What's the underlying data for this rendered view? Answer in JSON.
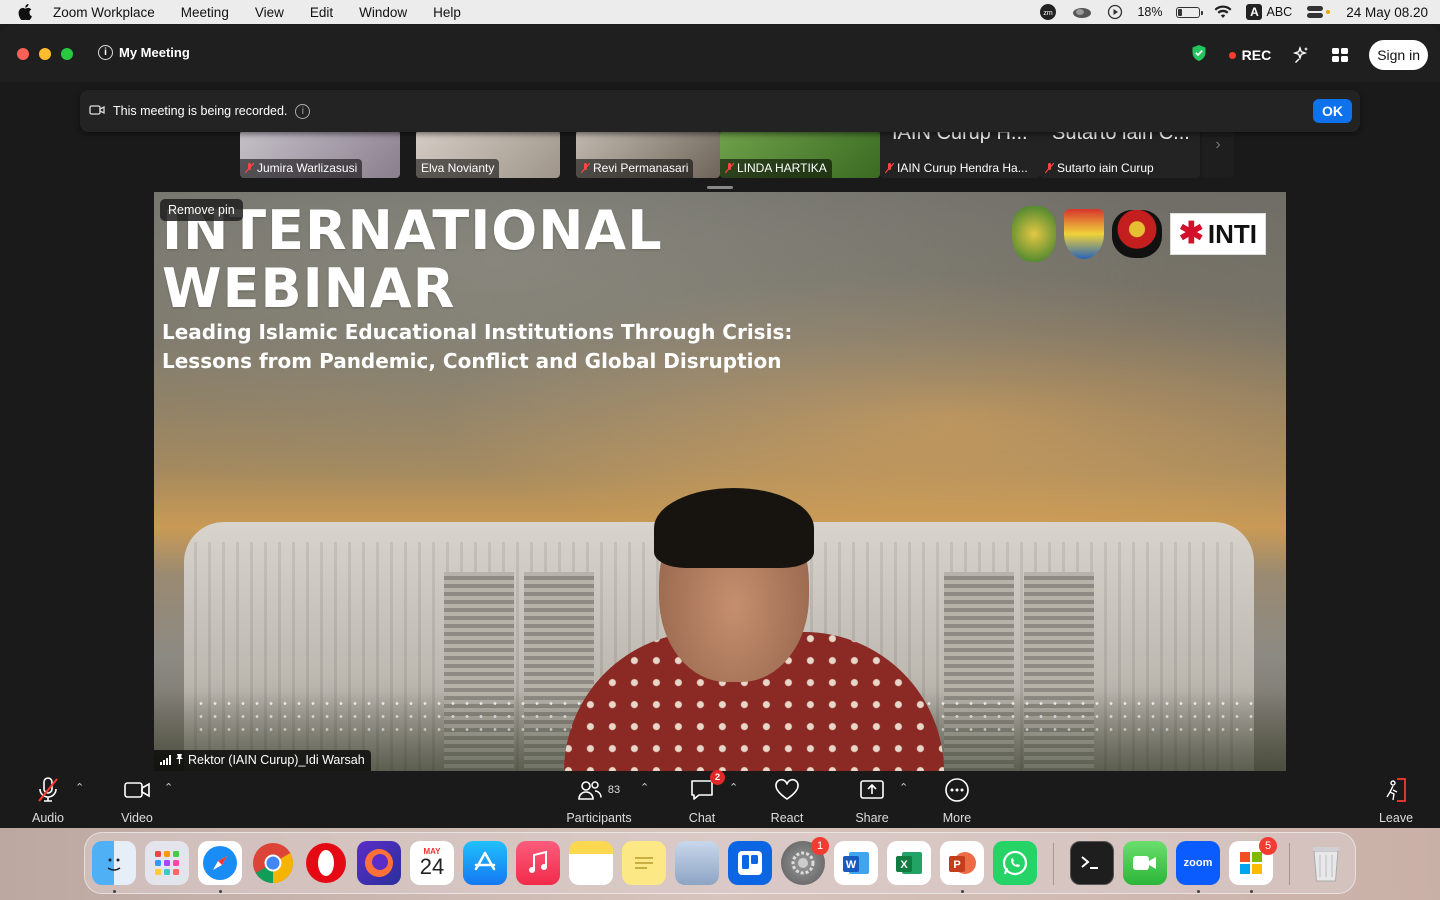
{
  "menubar": {
    "app_name": "Zoom Workplace",
    "menus": [
      "Meeting",
      "View",
      "Edit",
      "Window",
      "Help"
    ],
    "battery_percent": "18%",
    "input_source": "ABC",
    "datetime": "24 May  08.20"
  },
  "window": {
    "title": "My Meeting",
    "rec_label": "REC",
    "signin_label": "Sign in"
  },
  "banner": {
    "text": "This meeting is being recorded.",
    "ok_label": "OK"
  },
  "thumbnails": [
    {
      "name": "Jumira Warlizasusi",
      "muted": true
    },
    {
      "name": "Elva Novianty",
      "muted": false
    },
    {
      "name": "Revi Permanasari",
      "muted": true
    },
    {
      "name": "LINDA HARTIKA",
      "muted": true
    },
    {
      "name": "IAIN Curup Hendra Ha...",
      "tile_text": "IAIN Curup H...",
      "muted": true
    },
    {
      "name": "Sutarto iain Curup",
      "tile_text": "Sutarto iain C...",
      "muted": true
    }
  ],
  "video": {
    "remove_pin_label": "Remove pin",
    "speaker_name": "Rektor (IAIN Curup)_Idi Warsah",
    "slide_title_1": "INTERNATIONAL",
    "slide_title_2": "WEBINAR",
    "slide_subtitle_1": "Leading Islamic Educational Institutions Through Crisis:",
    "slide_subtitle_2": "Lessons from Pandemic, Conflict and Global Disruption",
    "logo_text": "INTI"
  },
  "toolbar": {
    "audio": "Audio",
    "video": "Video",
    "participants": "Participants",
    "participants_count": "83",
    "chat": "Chat",
    "chat_badge": "2",
    "react": "React",
    "share": "Share",
    "more": "More",
    "leave": "Leave"
  },
  "dock": {
    "calendar_month": "MAY",
    "calendar_day": "24",
    "settings_badge": "1",
    "office_badge": "5",
    "zoom_label": "zoom"
  },
  "colors": {
    "accent_blue": "#0e72ed",
    "rec_red": "#ff3b30",
    "toolbar_bg": "#1a1a1a"
  }
}
